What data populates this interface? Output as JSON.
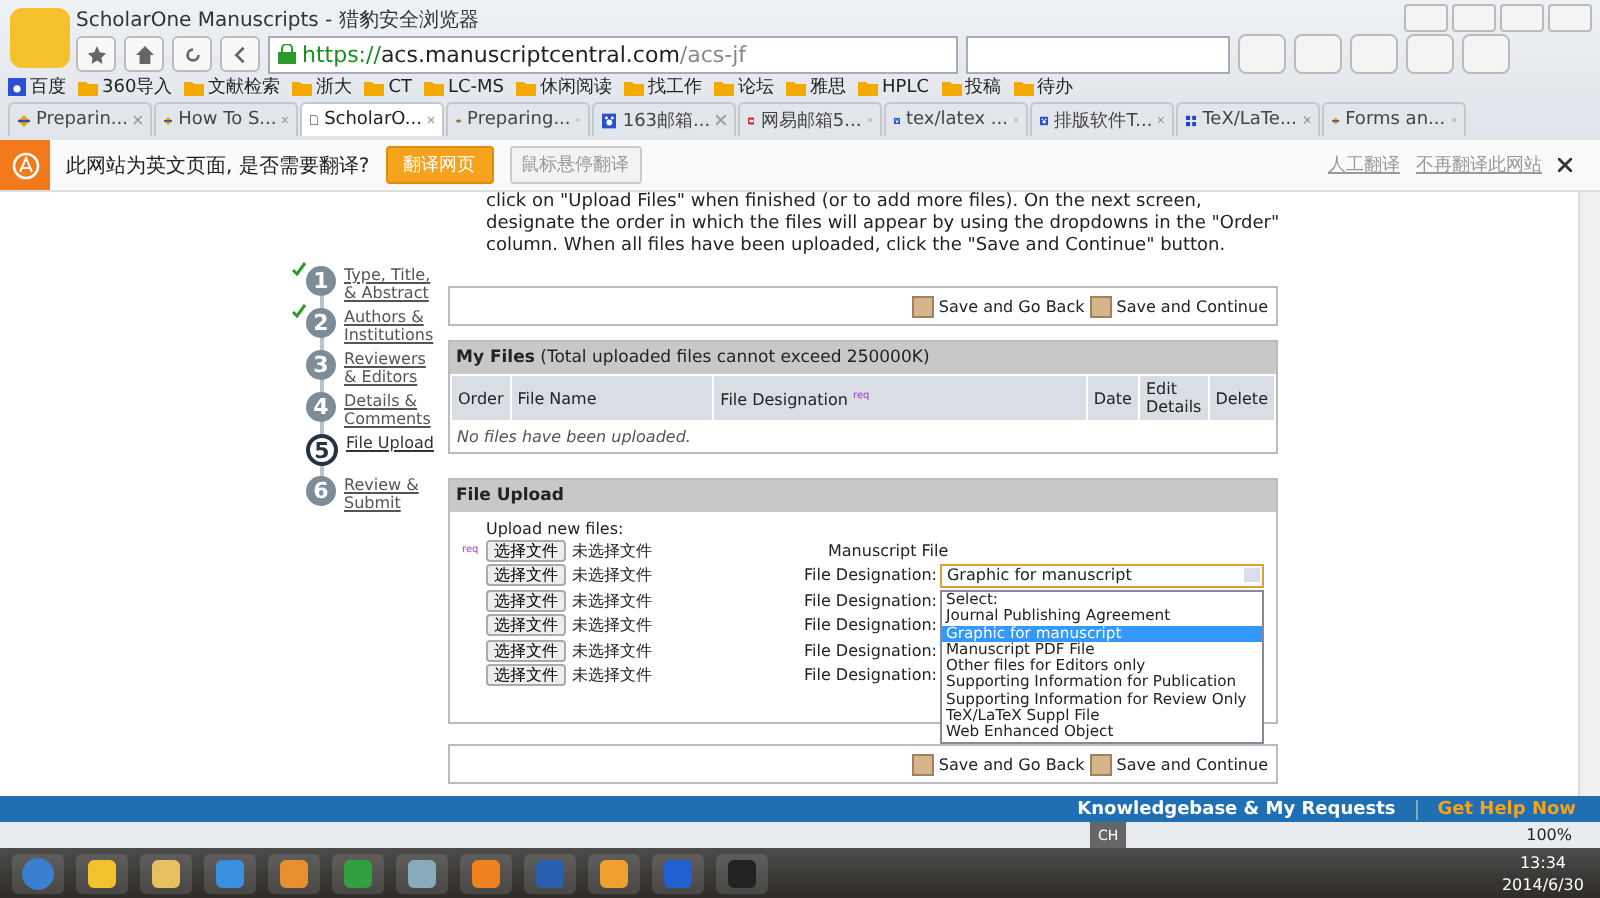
{
  "window": {
    "title": "ScholarOne Manuscripts - 猎豹安全浏览器"
  },
  "address_bar": {
    "scheme": "https://",
    "host": "acs.manuscriptcentral.com",
    "path": "/acs-jf"
  },
  "bookmarks": [
    {
      "label": "百度",
      "kind": "site"
    },
    {
      "label": "360导入",
      "kind": "folder"
    },
    {
      "label": "文献检索",
      "kind": "folder"
    },
    {
      "label": "浙大",
      "kind": "folder"
    },
    {
      "label": "CT",
      "kind": "folder"
    },
    {
      "label": "LC-MS",
      "kind": "folder"
    },
    {
      "label": "休闲阅读",
      "kind": "folder"
    },
    {
      "label": "找工作",
      "kind": "folder"
    },
    {
      "label": "论坛",
      "kind": "folder"
    },
    {
      "label": "雅思",
      "kind": "folder"
    },
    {
      "label": "HPLC",
      "kind": "folder"
    },
    {
      "label": "投稿",
      "kind": "folder"
    },
    {
      "label": "待办",
      "kind": "folder"
    }
  ],
  "tabs": [
    {
      "label": "Preparin...",
      "kind": "diamond",
      "selected": false
    },
    {
      "label": "How To S...",
      "kind": "diamond",
      "selected": false
    },
    {
      "label": "ScholarO...",
      "kind": "page",
      "selected": true
    },
    {
      "label": "Preparing...",
      "kind": "diamond",
      "selected": false
    },
    {
      "label": "163邮箱...",
      "kind": "paw",
      "selected": false
    },
    {
      "label": "网易邮箱5...",
      "kind": "mail",
      "selected": false
    },
    {
      "label": "tex/latex ...",
      "kind": "paw",
      "selected": false
    },
    {
      "label": "排版软件T...",
      "kind": "paw",
      "selected": false
    },
    {
      "label": "TeX/LaTe...",
      "kind": "grid",
      "selected": false
    },
    {
      "label": "Forms an...",
      "kind": "diamond",
      "selected": false
    }
  ],
  "translate_bar": {
    "message": "此网站为英文页面, 是否需要翻译?",
    "translate_button": "翻译网页",
    "hover_button": "鼠标悬停翻译",
    "links": [
      "人工翻译",
      "不再翻译此网站"
    ]
  },
  "instructions": "click on \"Upload Files\" when finished (or to add more files). On the next screen, designate the order in which the files will appear by using the dropdowns in the \"Order\" column. When all files have been uploaded, click the \"Save and Continue\" button.",
  "steps": [
    {
      "number": "1",
      "label": "Type, Title, & Abstract",
      "done": true,
      "selected": false
    },
    {
      "number": "2",
      "label": "Authors & Institutions",
      "done": true,
      "selected": false
    },
    {
      "number": "3",
      "label": "Reviewers & Editors",
      "done": false,
      "selected": false
    },
    {
      "number": "4",
      "label": "Details & Comments",
      "done": false,
      "selected": false
    },
    {
      "number": "5",
      "label": "File Upload",
      "done": false,
      "selected": true
    },
    {
      "number": "6",
      "label": "Review & Submit",
      "done": false,
      "selected": false
    }
  ],
  "top_actions": [
    "Save and Go Back",
    "Save and Continue"
  ],
  "my_files": {
    "title": "My Files",
    "note": "(Total uploaded files cannot exceed 250000K)",
    "columns": [
      {
        "label": "Order",
        "required": false
      },
      {
        "label": "File Name",
        "required": false
      },
      {
        "label": "File Designation",
        "required": true
      },
      {
        "label": "Date",
        "required": false
      },
      {
        "label": "Edit Details",
        "required": false
      },
      {
        "label": "Delete",
        "required": false
      }
    ],
    "required_mark": "req",
    "empty_message": "No files have been uploaded."
  },
  "file_upload": {
    "title": "File Upload",
    "prompt": "Upload new files:",
    "required_mark": "req",
    "first_label": "Manuscript File",
    "rows": [
      {
        "button": "选择文件",
        "status": "未选择文件"
      },
      {
        "button": "选择文件",
        "status": "未选择文件",
        "designation": "File Designation:"
      },
      {
        "button": "选择文件",
        "status": "未选择文件",
        "designation": "File Designation:"
      },
      {
        "button": "选择文件",
        "status": "未选择文件",
        "designation": "File Designation:"
      },
      {
        "button": "选择文件",
        "status": "未选择文件",
        "designation": "File Designation:"
      },
      {
        "button": "选择文件",
        "status": "未选择文件",
        "designation": "File Designation:"
      }
    ],
    "select_value": "Graphic for manuscript",
    "options": [
      {
        "label": "Select:",
        "selected": false
      },
      {
        "label": "Journal Publishing Agreement",
        "selected": false
      },
      {
        "label": "Graphic for manuscript",
        "selected": true
      },
      {
        "label": "Manuscript PDF File",
        "selected": false
      },
      {
        "label": "Other files for Editors only",
        "selected": false
      },
      {
        "label": "Supporting Information for Publication",
        "selected": false
      },
      {
        "label": "Supporting Information for Review Only",
        "selected": false
      },
      {
        "label": "TeX/LaTeX Suppl File",
        "selected": false
      },
      {
        "label": "Web Enhanced Object",
        "selected": false
      }
    ]
  },
  "bottom_actions": [
    "Save and Go Back",
    "Save and Continue"
  ],
  "footer": {
    "links": [
      "Knowledgebase & My Requests",
      "Get Help Now"
    ]
  },
  "status_bar": {
    "ime": "CH",
    "zoom": "100%"
  },
  "taskbar": {
    "time": "13:34",
    "date": "2014/6/30"
  }
}
